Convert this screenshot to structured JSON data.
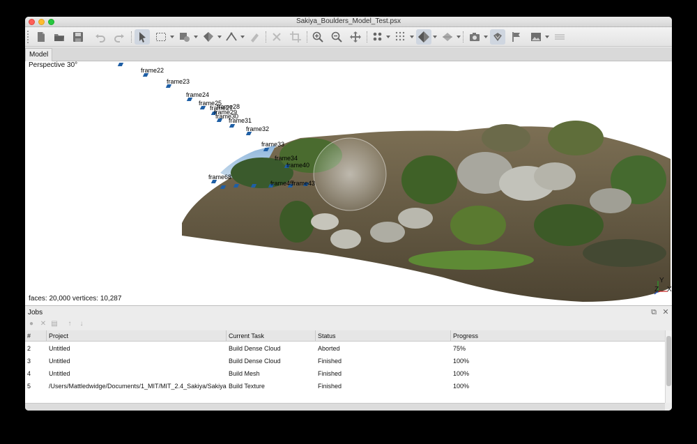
{
  "window": {
    "title": "Sakiya_Boulders_Model_Test.psx"
  },
  "toolbar": {
    "buttons": [
      {
        "name": "new-document-icon"
      },
      {
        "name": "open-folder-icon"
      },
      {
        "name": "save-icon"
      },
      {
        "name": "undo-icon"
      },
      {
        "name": "redo-icon"
      },
      {
        "name": "navigation-cursor-icon"
      },
      {
        "name": "rectangle-selection-icon"
      },
      {
        "name": "shape-tool-icon"
      },
      {
        "name": "region-tool-icon"
      },
      {
        "name": "ruler-angle-icon"
      },
      {
        "name": "eraser-icon"
      },
      {
        "name": "delete-x-icon"
      },
      {
        "name": "crop-icon"
      },
      {
        "name": "zoom-in-icon"
      },
      {
        "name": "zoom-out-icon"
      },
      {
        "name": "move-arrows-icon"
      },
      {
        "name": "point-cloud-icon"
      },
      {
        "name": "dense-cloud-icon"
      },
      {
        "name": "shaded-model-icon"
      },
      {
        "name": "tiled-model-icon"
      },
      {
        "name": "camera-icon"
      },
      {
        "name": "markers-icon"
      },
      {
        "name": "flag-icon"
      },
      {
        "name": "image-icon"
      },
      {
        "name": "layers-icon"
      }
    ]
  },
  "tabs": [
    {
      "label": "Model"
    }
  ],
  "viewport": {
    "perspective": "Perspective 30°",
    "stats": "faces: 20,000 vertices: 10,287",
    "axis": {
      "y": "Y",
      "z": "Z",
      "x": "X"
    },
    "frame_labels": [
      "frame22",
      "frame23",
      "frame24",
      "frame25",
      "frame28",
      "frame27",
      "frame29",
      "frame30",
      "frame31",
      "frame32",
      "frame33",
      "frame34",
      "frame40",
      "frame68",
      "frame45",
      "frame43"
    ]
  },
  "jobs": {
    "title": "Jobs",
    "columns": [
      "#",
      "Project",
      "Current Task",
      "Status",
      "Progress"
    ],
    "rows": [
      {
        "num": "2",
        "project": "Untitled",
        "task": "Build Dense Cloud",
        "status": "Aborted",
        "progress": "75%"
      },
      {
        "num": "3",
        "project": "Untitled",
        "task": "Build Dense Cloud",
        "status": "Finished",
        "progress": "100%"
      },
      {
        "num": "4",
        "project": "Untitled",
        "task": "Build Mesh",
        "status": "Finished",
        "progress": "100%"
      },
      {
        "num": "5",
        "project": "/Users/Mattledwidge/Documents/1_MIT/MIT_2.4_Sakiya/Sakiya...",
        "task": "Build Texture",
        "status": "Finished",
        "progress": "100%"
      }
    ]
  },
  "colors": {
    "camera_blue": "#1f5fa5",
    "close_red": "#fe5f57",
    "min_yellow": "#febc2e",
    "max_green": "#28c840"
  }
}
